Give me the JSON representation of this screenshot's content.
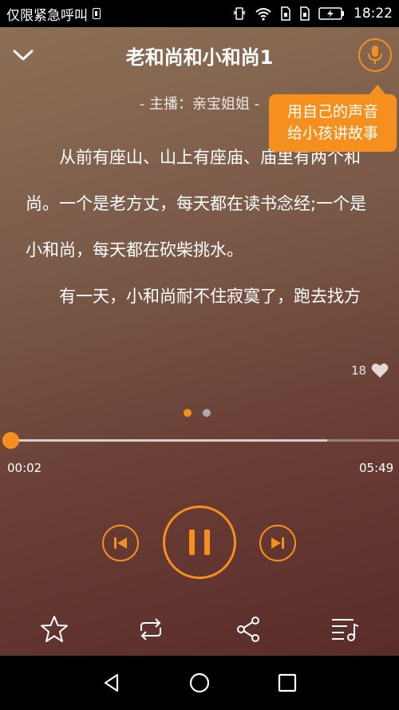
{
  "status_bar": {
    "carrier_text": "仅限紧急呼叫",
    "time": "18:22"
  },
  "player": {
    "title": "老和尚和小和尚1",
    "anchor": "- 主播：亲宝姐姐 -",
    "tooltip_line1": "用自己的声音",
    "tooltip_line2": "给小孩讲故事",
    "story_paragraph1": "从前有座山、山上有座庙、庙里有两个和尚。一个是老方丈，每天都在读书念经;一个是小和尚，每天都在砍柴挑水。",
    "story_paragraph2": "有一天，小和尚耐不住寂寞了，跑去找方丈：\"方丈，方丈，我想读书，\"方丈",
    "likes_count": "18",
    "current_time": "00:02",
    "total_time": "05:49",
    "progress_fraction": 0.0
  },
  "colors": {
    "accent": "#f5901f"
  },
  "icons": {
    "collapse": "chevron-down-icon",
    "mic": "microphone-icon",
    "like": "heart-icon",
    "prev": "previous-icon",
    "pause": "pause-icon",
    "next": "next-icon",
    "favorite": "star-icon",
    "loop": "repeat-icon",
    "share": "share-icon",
    "playlist": "playlist-icon"
  }
}
